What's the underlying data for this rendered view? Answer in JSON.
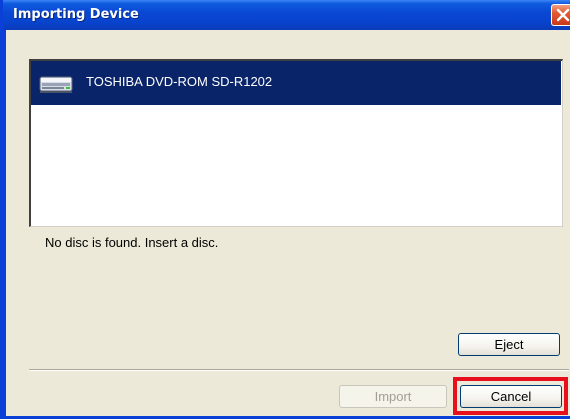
{
  "window": {
    "title": "Importing Device",
    "close_icon": "close-icon",
    "accent_color": "#0a3fd8",
    "close_color": "#e25a32"
  },
  "device_list": {
    "items": [
      {
        "icon": "dvd-drive-icon",
        "label": "TOSHIBA DVD-ROM SD-R1202",
        "selected": true
      }
    ],
    "selection_color": "#0a246a"
  },
  "status": {
    "message": "No disc is found. Insert a disc."
  },
  "buttons": {
    "eject_label": "Eject",
    "import_label": "Import",
    "import_enabled": false,
    "cancel_label": "Cancel",
    "cancel_highlighted": true,
    "highlight_color": "#e8101c"
  }
}
